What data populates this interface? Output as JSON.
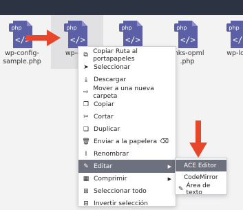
{
  "files": [
    {
      "icon_label": "php",
      "name": "wp-config-\nsample.php"
    },
    {
      "icon_label": "php",
      "name": "wp-con"
    },
    {
      "icon_label": "php",
      "name": ""
    },
    {
      "icon_label": "php",
      "name": "links-opml\n.php"
    },
    {
      "icon_label": "php",
      "name": "wp-load"
    }
  ],
  "context_menu": {
    "items": [
      {
        "icon": "copy-path-icon",
        "glyph": "⧉",
        "label": "Copiar Ruta al portapapeles"
      },
      {
        "icon": "cursor-icon",
        "glyph": "➤",
        "label": "Seleccionar"
      },
      {
        "icon": "download-icon",
        "glyph": "⤓",
        "label": "Descargar"
      },
      {
        "icon": "move-folder-icon",
        "glyph": "⇨",
        "label": "Mover a una nueva carpeta"
      },
      {
        "icon": "copy-icon",
        "glyph": "❐",
        "label": "Copiar"
      },
      {
        "icon": "scissors-icon",
        "glyph": "✂",
        "label": "Cortar"
      },
      {
        "icon": "duplicate-icon",
        "glyph": "❏",
        "label": "Duplicar"
      },
      {
        "icon": "trash-icon",
        "glyph": "🗑",
        "label": "Enviar a la papelera",
        "extra_glyph": "⌫"
      },
      {
        "icon": "rename-icon",
        "glyph": "I",
        "label": "Renombrar"
      },
      {
        "icon": "edit-icon",
        "glyph": "✎",
        "label": "Editar"
      },
      {
        "icon": "compress-icon",
        "glyph": "▦",
        "label": "Comprimir"
      },
      {
        "icon": "select-all-icon",
        "glyph": "⊞",
        "label": "Seleccionar todo"
      },
      {
        "icon": "invert-selection-icon",
        "glyph": "⊟",
        "label": "Invertir selección"
      }
    ],
    "highlighted": "Editar"
  },
  "submenu": {
    "items": [
      {
        "label": "ACE Editor"
      },
      {
        "label": "CodeMirror"
      },
      {
        "label": "Área de texto",
        "glyph": "✎"
      }
    ],
    "highlighted": "ACE Editor"
  },
  "colors": {
    "file_icon": "#5b5fa6",
    "highlight": "#6d717d",
    "annotation_arrow": "#e8462a",
    "topbar": "#2c3342"
  }
}
